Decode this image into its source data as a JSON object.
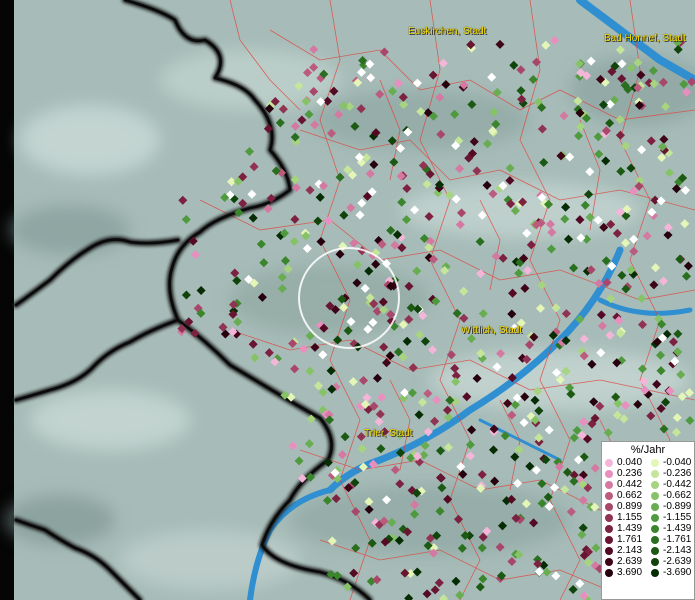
{
  "cities": [
    {
      "name": "Euskirchen, Stadt"
    },
    {
      "name": "Bad Honnef, Stadt"
    },
    {
      "name": "Wittlich, Stadt"
    },
    {
      "name": "Trier, Stadt"
    }
  ],
  "legend": {
    "title": "%/Jahr",
    "positive": [
      {
        "value": "0.040",
        "color": "#f4b6d8"
      },
      {
        "value": "0.236",
        "color": "#e98fbf"
      },
      {
        "value": "0.442",
        "color": "#d47aa2"
      },
      {
        "value": "0.662",
        "color": "#bb5c7e"
      },
      {
        "value": "0.899",
        "color": "#a8476a"
      },
      {
        "value": "1.155",
        "color": "#913353"
      },
      {
        "value": "1.439",
        "color": "#7c2240"
      },
      {
        "value": "1.761",
        "color": "#681531"
      },
      {
        "value": "2.143",
        "color": "#540a23"
      },
      {
        "value": "2.639",
        "color": "#3f0418"
      },
      {
        "value": "3.690",
        "color": "#26000c"
      }
    ],
    "negative": [
      {
        "value": "-0.040",
        "color": "#e4f5b8"
      },
      {
        "value": "-0.236",
        "color": "#c5e69a"
      },
      {
        "value": "-0.442",
        "color": "#a6d47f"
      },
      {
        "value": "-0.662",
        "color": "#86c267"
      },
      {
        "value": "-0.899",
        "color": "#69ad52"
      },
      {
        "value": "-1.155",
        "color": "#4f9a3e"
      },
      {
        "value": "-1.439",
        "color": "#3b852d"
      },
      {
        "value": "-1.761",
        "color": "#2a6f1f"
      },
      {
        "value": "-2.143",
        "color": "#1c5a14"
      },
      {
        "value": "-2.639",
        "color": "#10440b"
      },
      {
        "value": "-3.690",
        "color": "#052c03"
      }
    ]
  },
  "colors": {
    "terrain": "#a7bcb8",
    "water": "#2f8fd0",
    "district_lines": "#e0443e",
    "country_border": "#1a1a1a",
    "label": "#ffe400",
    "zero_marker": "#ffffff"
  }
}
